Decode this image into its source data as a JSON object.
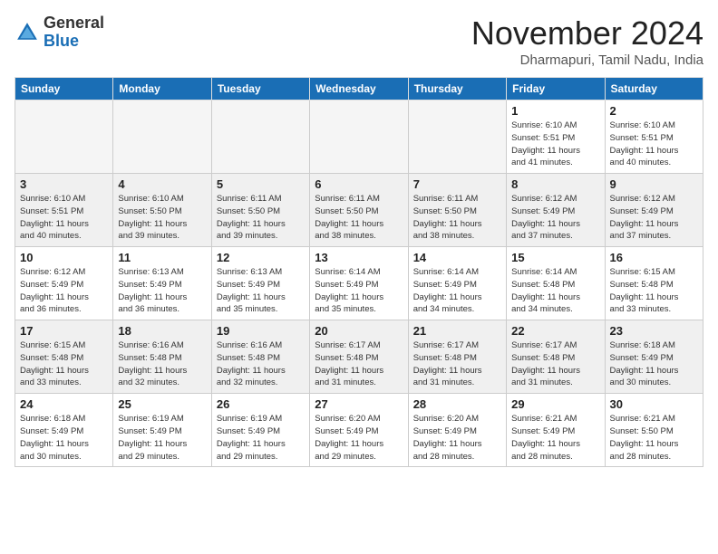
{
  "header": {
    "logo_general": "General",
    "logo_blue": "Blue",
    "month_title": "November 2024",
    "location": "Dharmapuri, Tamil Nadu, India"
  },
  "calendar": {
    "headers": [
      "Sunday",
      "Monday",
      "Tuesday",
      "Wednesday",
      "Thursday",
      "Friday",
      "Saturday"
    ],
    "rows": [
      {
        "shaded": false,
        "days": [
          {
            "num": "",
            "info": "",
            "empty": true
          },
          {
            "num": "",
            "info": "",
            "empty": true
          },
          {
            "num": "",
            "info": "",
            "empty": true
          },
          {
            "num": "",
            "info": "",
            "empty": true
          },
          {
            "num": "",
            "info": "",
            "empty": true
          },
          {
            "num": "1",
            "info": "Sunrise: 6:10 AM\nSunset: 5:51 PM\nDaylight: 11 hours\nand 41 minutes.",
            "empty": false
          },
          {
            "num": "2",
            "info": "Sunrise: 6:10 AM\nSunset: 5:51 PM\nDaylight: 11 hours\nand 40 minutes.",
            "empty": false
          }
        ]
      },
      {
        "shaded": true,
        "days": [
          {
            "num": "3",
            "info": "Sunrise: 6:10 AM\nSunset: 5:51 PM\nDaylight: 11 hours\nand 40 minutes.",
            "empty": false
          },
          {
            "num": "4",
            "info": "Sunrise: 6:10 AM\nSunset: 5:50 PM\nDaylight: 11 hours\nand 39 minutes.",
            "empty": false
          },
          {
            "num": "5",
            "info": "Sunrise: 6:11 AM\nSunset: 5:50 PM\nDaylight: 11 hours\nand 39 minutes.",
            "empty": false
          },
          {
            "num": "6",
            "info": "Sunrise: 6:11 AM\nSunset: 5:50 PM\nDaylight: 11 hours\nand 38 minutes.",
            "empty": false
          },
          {
            "num": "7",
            "info": "Sunrise: 6:11 AM\nSunset: 5:50 PM\nDaylight: 11 hours\nand 38 minutes.",
            "empty": false
          },
          {
            "num": "8",
            "info": "Sunrise: 6:12 AM\nSunset: 5:49 PM\nDaylight: 11 hours\nand 37 minutes.",
            "empty": false
          },
          {
            "num": "9",
            "info": "Sunrise: 6:12 AM\nSunset: 5:49 PM\nDaylight: 11 hours\nand 37 minutes.",
            "empty": false
          }
        ]
      },
      {
        "shaded": false,
        "days": [
          {
            "num": "10",
            "info": "Sunrise: 6:12 AM\nSunset: 5:49 PM\nDaylight: 11 hours\nand 36 minutes.",
            "empty": false
          },
          {
            "num": "11",
            "info": "Sunrise: 6:13 AM\nSunset: 5:49 PM\nDaylight: 11 hours\nand 36 minutes.",
            "empty": false
          },
          {
            "num": "12",
            "info": "Sunrise: 6:13 AM\nSunset: 5:49 PM\nDaylight: 11 hours\nand 35 minutes.",
            "empty": false
          },
          {
            "num": "13",
            "info": "Sunrise: 6:14 AM\nSunset: 5:49 PM\nDaylight: 11 hours\nand 35 minutes.",
            "empty": false
          },
          {
            "num": "14",
            "info": "Sunrise: 6:14 AM\nSunset: 5:49 PM\nDaylight: 11 hours\nand 34 minutes.",
            "empty": false
          },
          {
            "num": "15",
            "info": "Sunrise: 6:14 AM\nSunset: 5:48 PM\nDaylight: 11 hours\nand 34 minutes.",
            "empty": false
          },
          {
            "num": "16",
            "info": "Sunrise: 6:15 AM\nSunset: 5:48 PM\nDaylight: 11 hours\nand 33 minutes.",
            "empty": false
          }
        ]
      },
      {
        "shaded": true,
        "days": [
          {
            "num": "17",
            "info": "Sunrise: 6:15 AM\nSunset: 5:48 PM\nDaylight: 11 hours\nand 33 minutes.",
            "empty": false
          },
          {
            "num": "18",
            "info": "Sunrise: 6:16 AM\nSunset: 5:48 PM\nDaylight: 11 hours\nand 32 minutes.",
            "empty": false
          },
          {
            "num": "19",
            "info": "Sunrise: 6:16 AM\nSunset: 5:48 PM\nDaylight: 11 hours\nand 32 minutes.",
            "empty": false
          },
          {
            "num": "20",
            "info": "Sunrise: 6:17 AM\nSunset: 5:48 PM\nDaylight: 11 hours\nand 31 minutes.",
            "empty": false
          },
          {
            "num": "21",
            "info": "Sunrise: 6:17 AM\nSunset: 5:48 PM\nDaylight: 11 hours\nand 31 minutes.",
            "empty": false
          },
          {
            "num": "22",
            "info": "Sunrise: 6:17 AM\nSunset: 5:48 PM\nDaylight: 11 hours\nand 31 minutes.",
            "empty": false
          },
          {
            "num": "23",
            "info": "Sunrise: 6:18 AM\nSunset: 5:49 PM\nDaylight: 11 hours\nand 30 minutes.",
            "empty": false
          }
        ]
      },
      {
        "shaded": false,
        "days": [
          {
            "num": "24",
            "info": "Sunrise: 6:18 AM\nSunset: 5:49 PM\nDaylight: 11 hours\nand 30 minutes.",
            "empty": false
          },
          {
            "num": "25",
            "info": "Sunrise: 6:19 AM\nSunset: 5:49 PM\nDaylight: 11 hours\nand 29 minutes.",
            "empty": false
          },
          {
            "num": "26",
            "info": "Sunrise: 6:19 AM\nSunset: 5:49 PM\nDaylight: 11 hours\nand 29 minutes.",
            "empty": false
          },
          {
            "num": "27",
            "info": "Sunrise: 6:20 AM\nSunset: 5:49 PM\nDaylight: 11 hours\nand 29 minutes.",
            "empty": false
          },
          {
            "num": "28",
            "info": "Sunrise: 6:20 AM\nSunset: 5:49 PM\nDaylight: 11 hours\nand 28 minutes.",
            "empty": false
          },
          {
            "num": "29",
            "info": "Sunrise: 6:21 AM\nSunset: 5:49 PM\nDaylight: 11 hours\nand 28 minutes.",
            "empty": false
          },
          {
            "num": "30",
            "info": "Sunrise: 6:21 AM\nSunset: 5:50 PM\nDaylight: 11 hours\nand 28 minutes.",
            "empty": false
          }
        ]
      }
    ]
  }
}
